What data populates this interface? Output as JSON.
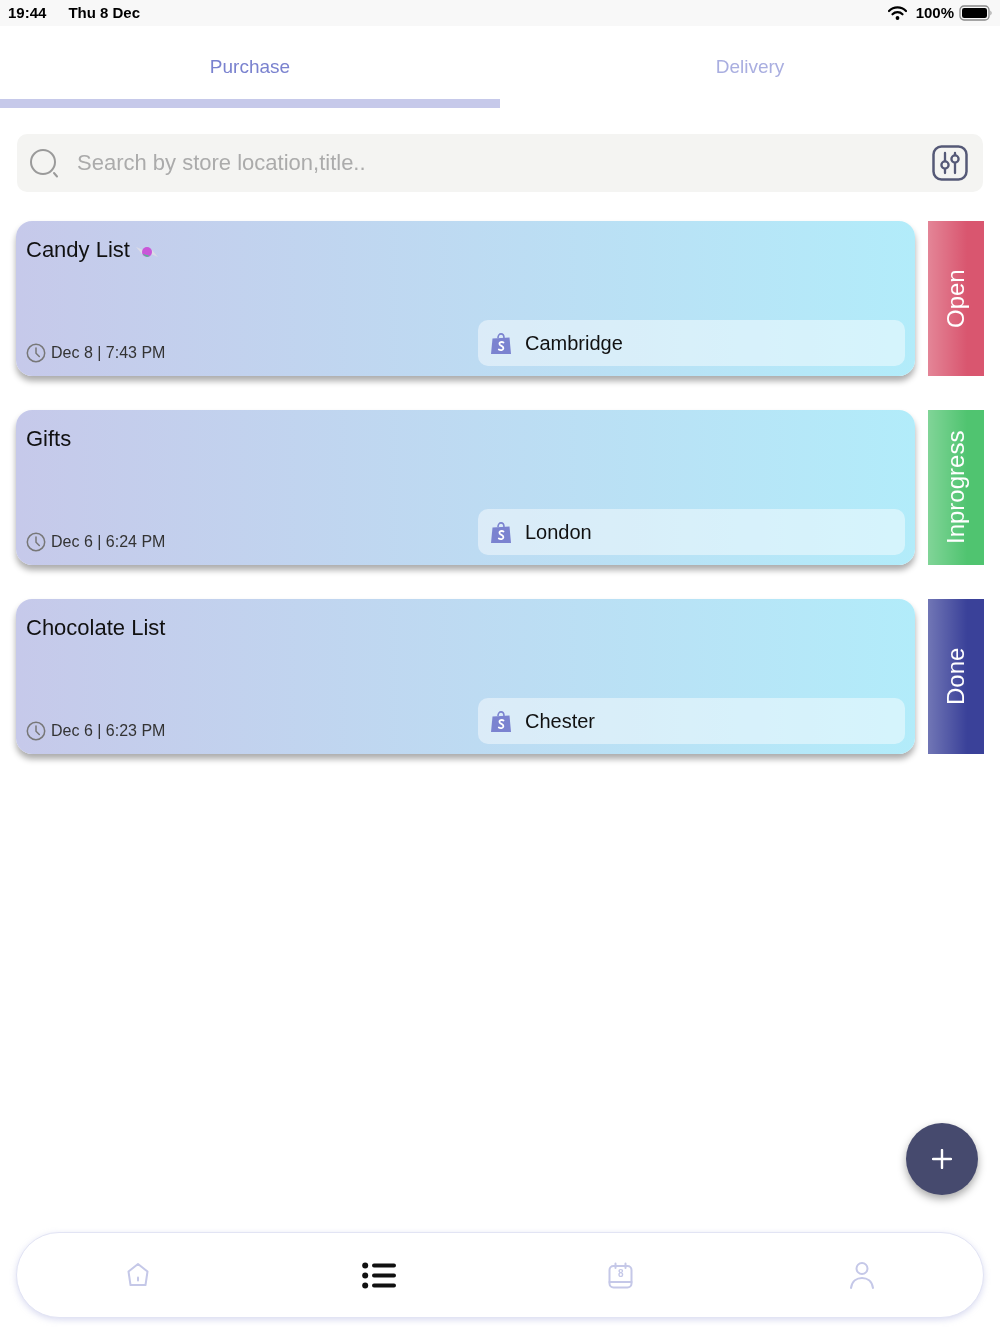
{
  "status_bar": {
    "time": "19:44",
    "date": "Thu 8 Dec",
    "battery": "100%"
  },
  "tabs": [
    {
      "label": "Purchase",
      "selected": true
    },
    {
      "label": "Delivery",
      "selected": false
    }
  ],
  "search": {
    "placeholder": "Search by store location,title.."
  },
  "lists": [
    {
      "title": "Candy List",
      "candy_icon": true,
      "date": "Dec 8 | 7:43 PM",
      "store": "Cambridge",
      "status": {
        "label": "Open",
        "color": "#d9566f"
      }
    },
    {
      "title": "Gifts",
      "candy_icon": false,
      "date": "Dec 6 | 6:24 PM",
      "store": "London",
      "status": {
        "label": "Inprogress",
        "color": "#50c470"
      }
    },
    {
      "title": "Chocolate List",
      "candy_icon": false,
      "date": "Dec 6 | 6:23 PM",
      "store": "Chester",
      "status": {
        "label": "Done",
        "color": "#3a4199"
      }
    }
  ],
  "nav": [
    {
      "kind": "home",
      "selected": false
    },
    {
      "kind": "list",
      "selected": true
    },
    {
      "kind": "calendar",
      "selected": false,
      "day": "8"
    },
    {
      "kind": "profile",
      "selected": false
    }
  ]
}
